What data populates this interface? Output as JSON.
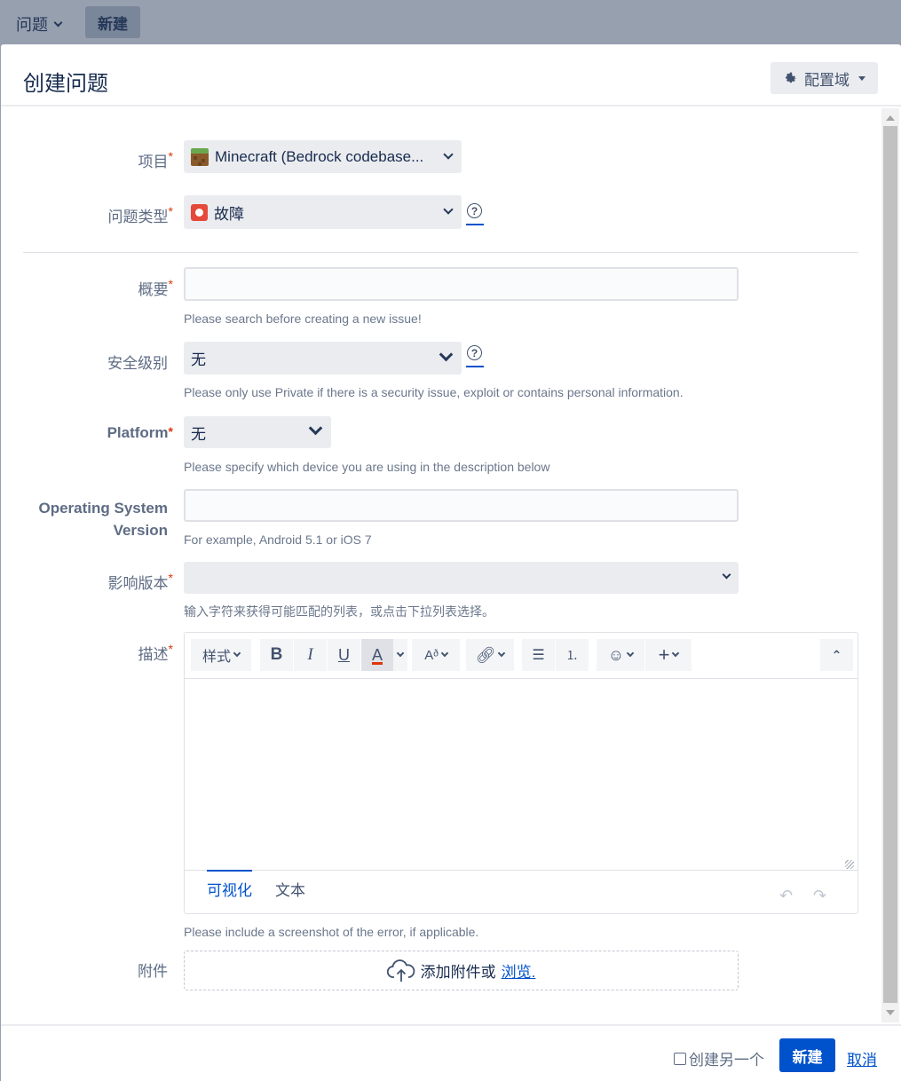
{
  "topnav": {
    "menu_label": "问题",
    "new_label": "新建"
  },
  "dialog": {
    "title": "创建问题",
    "config_label": "配置域"
  },
  "fields": {
    "project": {
      "label": "项目",
      "value": "Minecraft (Bedrock codebase..."
    },
    "issue_type": {
      "label": "问题类型",
      "value": "故障"
    },
    "summary": {
      "label": "概要",
      "value": "",
      "description": "Please search before creating a new issue!"
    },
    "security_level": {
      "label": "安全级别",
      "value": "无",
      "description": "Please only use Private if there is a security issue, exploit or contains personal information."
    },
    "platform": {
      "label": "Platform",
      "value": "无",
      "description": "Please specify which device you are using in the description below"
    },
    "os_version": {
      "label_line1": "Operating System",
      "label_line2": "Version",
      "value": "",
      "description": "For example, Android 5.1 or iOS 7"
    },
    "affects_version": {
      "label": "影响版本",
      "value": "",
      "description": "输入字符来获得可能匹配的列表，或点击下拉列表选择。"
    },
    "description": {
      "label": "描述",
      "value": "",
      "description": "Please include a screenshot of the error, if applicable."
    },
    "attachment": {
      "label": "附件",
      "text": "添加附件或",
      "browse": "浏览."
    }
  },
  "editor": {
    "style_label": "样式",
    "bold": "B",
    "italic": "I",
    "underline": "U",
    "text_color": "A",
    "mode_visual": "可视化",
    "mode_text": "文本"
  },
  "footer": {
    "create_another": "创建另一个",
    "create_another_checked": false,
    "submit": "新建",
    "cancel": "取消"
  },
  "colors": {
    "primary": "#0052cc",
    "required": "#de350b",
    "bug": "#e5493a"
  }
}
